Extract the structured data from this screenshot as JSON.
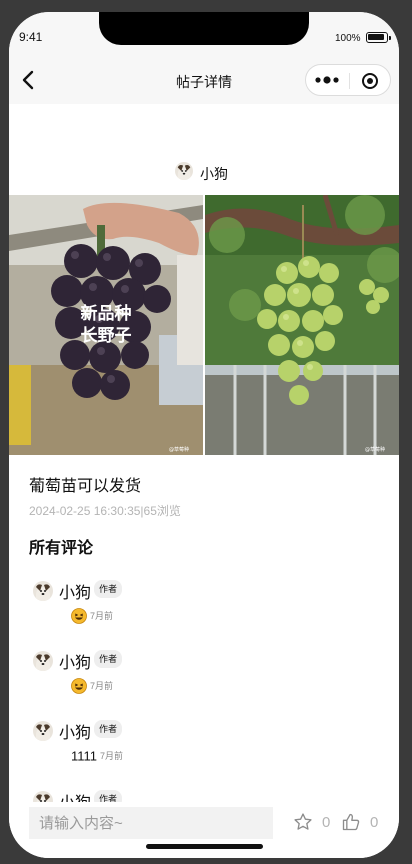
{
  "status_bar": {
    "time": "9:41",
    "battery": "100%"
  },
  "nav": {
    "title": "帖子详情"
  },
  "post": {
    "author": "小狗",
    "image_left_caption": [
      "新品种",
      "长野子"
    ],
    "image_watermark": "@草莓种",
    "title": "葡萄苗可以发货",
    "meta": "2024-02-25 16:30:35|65浏览"
  },
  "comments_section": {
    "title": "所有评论",
    "comments": [
      {
        "name": "小狗",
        "badge": "作者",
        "emoji": "grinning-face",
        "text": "",
        "time": "7月前"
      },
      {
        "name": "小狗",
        "badge": "作者",
        "emoji": "grinning-face",
        "text": "",
        "time": "7月前"
      },
      {
        "name": "小狗",
        "badge": "作者",
        "emoji": "",
        "text": "1111",
        "time": "7月前"
      },
      {
        "name": "小狗",
        "badge": "作者",
        "emoji": "",
        "text": "",
        "time": ""
      }
    ]
  },
  "bottom_bar": {
    "placeholder": "请输入内容~",
    "favorites": "0",
    "likes": "0"
  },
  "icons": {
    "back": "chevron-left-icon",
    "more": "more-dots-icon",
    "target": "target-icon",
    "star": "star-outline-icon",
    "like": "thumbs-up-icon",
    "emoji": "grinning-face-icon"
  },
  "colors": {
    "meta_gray": "#b4b4b4",
    "background": "#ffffff",
    "nav_bg": "#f7f7f7"
  }
}
